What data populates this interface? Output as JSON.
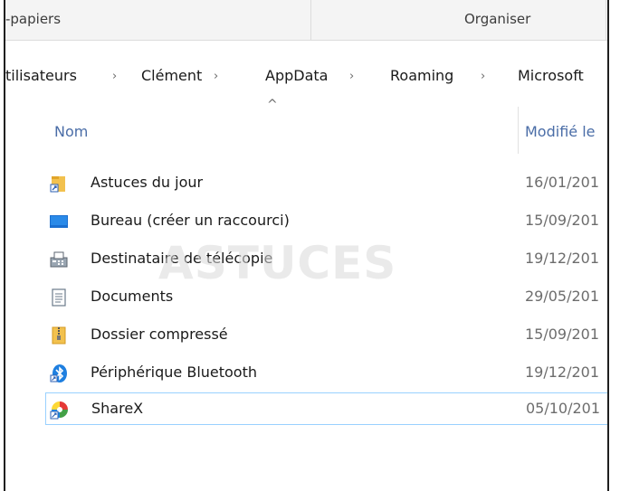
{
  "ribbon": {
    "group_left": "-papiers",
    "group_right": "Organiser"
  },
  "breadcrumb": {
    "items": [
      "tilisateurs",
      "Clément",
      "AppData",
      "Roaming",
      "Microsoft"
    ]
  },
  "columns": {
    "name": "Nom",
    "modified": "Modifié le"
  },
  "files": [
    {
      "name": "Astuces du jour",
      "date": "16/01/201",
      "icon": "folder-shortcut-icon"
    },
    {
      "name": "Bureau (créer un raccourci)",
      "date": "15/09/201",
      "icon": "desktop-icon"
    },
    {
      "name": "Destinataire de télécopie",
      "date": "19/12/201",
      "icon": "fax-icon"
    },
    {
      "name": "Documents",
      "date": "29/05/201",
      "icon": "document-icon"
    },
    {
      "name": "Dossier compressé",
      "date": "15/09/201",
      "icon": "zip-folder-icon"
    },
    {
      "name": "Périphérique Bluetooth",
      "date": "19/12/201",
      "icon": "bluetooth-icon"
    },
    {
      "name": "ShareX",
      "date": "05/10/201",
      "icon": "sharex-icon"
    }
  ],
  "watermark": "ASTUCES",
  "colors": {
    "header_text": "#4a6da7",
    "selection_border": "#99d1ff",
    "folder_yellow": "#f2c14e",
    "bluetooth_blue": "#1e7fe0"
  }
}
